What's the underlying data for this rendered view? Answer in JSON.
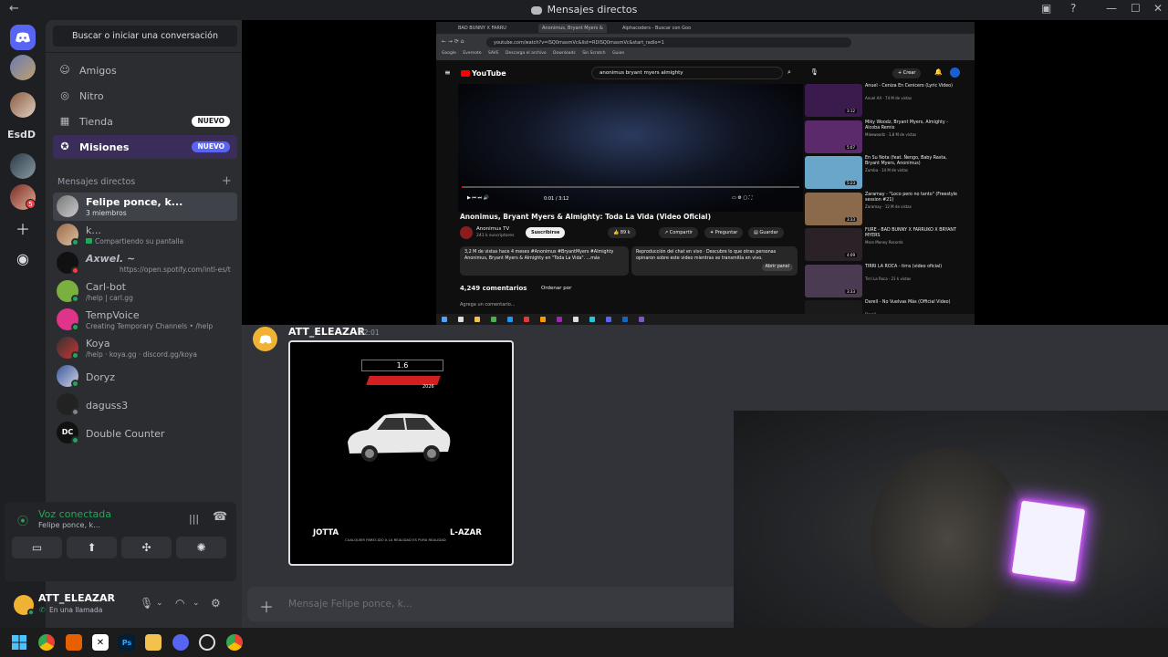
{
  "window": {
    "title": "Mensajes directos"
  },
  "sidebar": {
    "search_placeholder": "Buscar o iniciar una conversación",
    "nav": [
      {
        "label": "Amigos",
        "icon": "friends-icon"
      },
      {
        "label": "Nitro",
        "icon": "nitro-icon"
      },
      {
        "label": "Tienda",
        "icon": "shop-icon",
        "badge": "NUEVO"
      },
      {
        "label": "Misiones",
        "icon": "quests-icon",
        "badge": "NUEVO"
      }
    ],
    "dm_header": "Mensajes directos",
    "dms": [
      {
        "name": "Felipe ponce, k...",
        "sub": "3 miembros"
      },
      {
        "name": "k...",
        "sub": "Compartiendo su pantalla"
      },
      {
        "name": "Axwel. ~",
        "sub": "https://open.spotify.com/intl-es/t"
      },
      {
        "name": "Carl-bot",
        "sub": "/help | carl.gg"
      },
      {
        "name": "TempVoice",
        "sub": "Creating Temporary Channels • /help"
      },
      {
        "name": "Koya",
        "sub": "/help · koya.gg · discord.gg/koya"
      },
      {
        "name": "Doryz",
        "sub": ""
      },
      {
        "name": "daguss3",
        "sub": ""
      },
      {
        "name": "Double Counter",
        "sub": ""
      }
    ]
  },
  "guilds": {
    "esd_label": "EsdD",
    "badge": "5"
  },
  "voice": {
    "status": "Voz conectada",
    "channel": "Felipe ponce, k..."
  },
  "user": {
    "name": "ATT_ELEAZAR",
    "status": "En una llamada"
  },
  "stream": {
    "tabs": [
      "BAD BUNNY X FARRU",
      "Anonimus, Bryant Myers &",
      "Alphacoders - Buscar con Goo"
    ],
    "url": "youtube.com/watch?v=lSQ0masmVc&list=RDlSQ0masmVc&start_radio=1",
    "bookmarks": [
      "Google",
      "Evernote",
      "SAVE",
      "Descarga el archivo",
      "Downloads",
      "Sin Scratch",
      "Guion"
    ],
    "search_query": "anonimus bryant myers almighty",
    "crear": "+ Crear",
    "video_time": "0:01 / 3:12",
    "video_title": "Anonimus, Bryant Myers & Almighty: Toda La Vida (Video Oficial)",
    "channel_name": "Anonimus TV",
    "channel_subs": "241 k suscriptores",
    "subscribe": "Suscribirse",
    "likes": "89 k",
    "share": "Compartir",
    "ask": "Preguntar",
    "save": "Guardar",
    "description": "3,2 M de vistas  hace 4 meses  #Anonimus #BryantMyers #Almighty Anonimus, Bryant Myers & Almighty en \"Toda La Vida\". ...más",
    "chat_replay": "Reproducción del chat en vivo · Descubre lo que otras personas opinaron sobre este video mientras se transmitía en vivo.",
    "open_panel": "Abrir panel",
    "comments": "4,249 comentarios",
    "sort": "Ordenar por",
    "add_comment": "Agrega un comentario...",
    "recs": [
      {
        "title": "Anuel - Ceniza En Cenicero (Lyric Video)",
        "meta": "Anuel AA · 74 M de vistas",
        "dur": "3:12",
        "color": "#3b1a4d"
      },
      {
        "title": "Miky Woodz, Bryant Myers, Almighty - Alcoba Remix",
        "meta": "Mikewoodz · 3,8 M de vistas",
        "dur": "5:07",
        "color": "#5a2a6b"
      },
      {
        "title": "En Su Nota (feat. Ñengo, Baby Rasta, Bryant Myers, Anonimus)",
        "meta": "Zumba · 14 M de vistas",
        "dur": "5:23",
        "color": "#6aa6c9"
      },
      {
        "title": "Zaramay - \"Loco pero no tanto\" (Freestyle session #21)",
        "meta": "Zaramay · 12 M de vistas",
        "dur": "3:33",
        "color": "#8a6a4a"
      },
      {
        "title": "FURE - BAD BUNNY X FARRUKO X BRYANT MYERS",
        "meta": "More Money Records",
        "dur": "4:09",
        "color": "#2a2226"
      },
      {
        "title": "TIRRI LA ROCA - tirra (video oficial)",
        "meta": "Tirri La Roca · 21 k vistas",
        "dur": "3:33",
        "color": "#4a3a52"
      },
      {
        "title": "Darell - No Vuelvas Más (Official Video)",
        "meta": "Darell",
        "dur": "",
        "color": "#1a1a1a"
      }
    ]
  },
  "message": {
    "author": "ATT_ELEAZAR",
    "time": "02:01",
    "attachment": {
      "search_text": "1.6",
      "year": "2026",
      "left_artist": "JOTTA",
      "right_artist": "L-AZAR",
      "disclaimer": "CUALQUIER PARECIDO A LA REALIDAD ES PURA REALIDAD"
    }
  },
  "composer": {
    "placeholder": "Mensaje Felipe ponce, k..."
  },
  "colors": {
    "brand": "#5865f2",
    "online": "#23a55a",
    "idle": "#f0b232",
    "dnd": "#f23f43",
    "quest_badge": "#5865f2"
  }
}
